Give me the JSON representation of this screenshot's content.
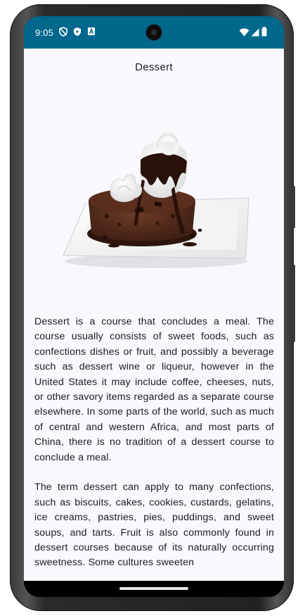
{
  "status_bar": {
    "time": "9:05",
    "left_icons": [
      "shield-off-icon",
      "shield-lock-icon",
      "font-a-icon"
    ],
    "right_icons": [
      "wifi-icon",
      "signal-icon",
      "battery-icon"
    ],
    "background_color": "#00678d"
  },
  "page": {
    "title": "Dessert",
    "image_icon": "chocolate-lava-cake-image",
    "paragraphs": [
      "Dessert is a course that concludes a meal. The course usually consists of sweet foods, such as confections dishes or fruit, and possibly a beverage such as dessert wine or liqueur, however in the United States it may include coffee, cheeses, nuts, or other savory items regarded as a separate course elsewhere. In some parts of the world, such as much of central and western Africa, and most parts of China, there is no tradition of a dessert course to conclude a meal.",
      "The term dessert can apply to many confections, such as biscuits, cakes, cookies, custards, gelatins, ice creams, pastries, pies, puddings, and sweet soups, and tarts. Fruit is also commonly found in dessert courses because of its naturally occurring sweetness. Some cultures sweeten"
    ]
  }
}
